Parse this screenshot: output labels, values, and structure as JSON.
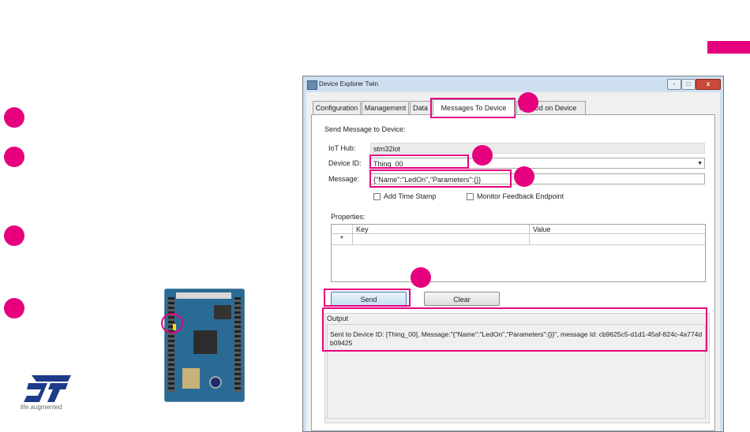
{
  "theme": {
    "accent": "#e6007e",
    "board": "#2a6b96"
  },
  "window": {
    "title": "Device Explorer Twin",
    "minimize": "-",
    "maximize": "□",
    "close": "x"
  },
  "tabs": [
    {
      "label": "Configuration"
    },
    {
      "label": "Management"
    },
    {
      "label": "Data"
    },
    {
      "label": "Messages To Device"
    },
    {
      "label": "Call Method on Device"
    }
  ],
  "send_message": {
    "heading": "Send Message to Device:",
    "iot_hub_label": "IoT Hub:",
    "iot_hub_value": "stm32iot",
    "device_id_label": "Device ID:",
    "device_id_value": "Thing_00",
    "message_label": "Message:",
    "message_value": "{\"Name\":\"LedOn\",\"Parameters\":{}}",
    "add_timestamp_label": "Add Time Stamp",
    "monitor_feedback_label": "Monitor Feedback Endpoint"
  },
  "properties": {
    "label": "Properties:",
    "columns": [
      "Key",
      "Value"
    ],
    "new_row_marker": "*"
  },
  "buttons": {
    "send": "Send",
    "clear": "Clear"
  },
  "output": {
    "label": "Output",
    "text": "Sent to Device ID: [Thing_00], Message:\"{\"Name\":\"LedOn\",\"Parameters\":{}}\", message Id: cb9625c5-d1d1-45af-824c-4a774db09425"
  },
  "logo": {
    "brand": "ST",
    "tagline": "life.augmented",
    "icon": "st-logo-icon"
  },
  "icons": {
    "board": "stm32-board-photo",
    "app": "app-window-icon",
    "dropdown": "chevron-down-icon"
  }
}
